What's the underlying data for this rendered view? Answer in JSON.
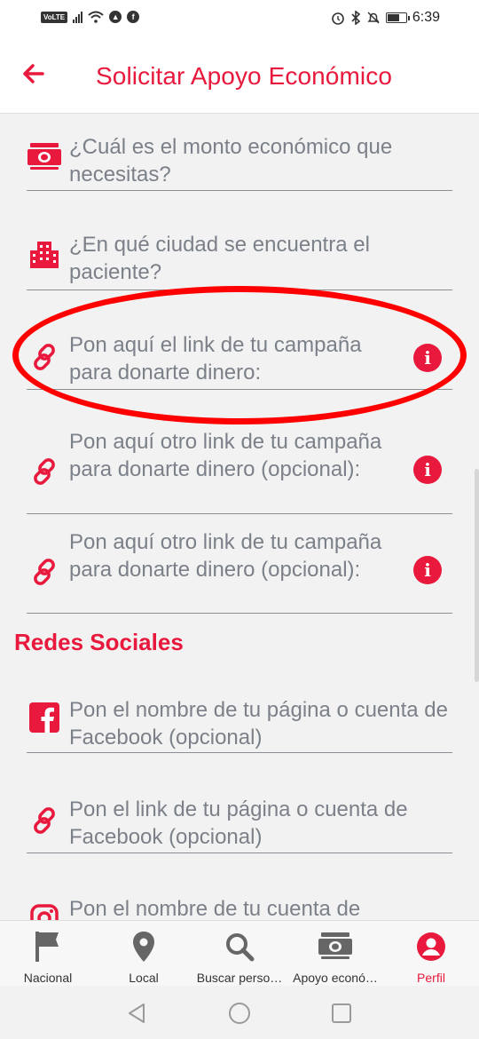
{
  "status_bar": {
    "time": "6:39",
    "volte": "VoLTE"
  },
  "app_bar": {
    "title": "Solicitar Apoyo Económico",
    "back_icon": "back-arrow-icon"
  },
  "fields": [
    {
      "icon": "money-icon",
      "text": "¿Cuál es el monto económico que necesitas?",
      "info": false
    },
    {
      "icon": "city-icon",
      "text": "¿En qué ciudad se encuentra el paciente?",
      "info": false
    },
    {
      "icon": "link-icon",
      "text": "Pon aquí el link de tu campaña para donarte dinero:",
      "info": true
    },
    {
      "icon": "link-icon",
      "text": "Pon aquí otro link de tu campaña para donarte dinero (opcional):",
      "info": true
    },
    {
      "icon": "link-icon",
      "text": "Pon aquí otro link de tu campaña para donarte dinero (opcional):",
      "info": true
    }
  ],
  "social_section": {
    "title": "Redes Sociales",
    "fields": [
      {
        "icon": "facebook-icon",
        "text": "Pon el nombre de tu página o cuenta de Facebook (opcional)"
      },
      {
        "icon": "link-icon",
        "text": "Pon el link de tu página o cuenta de Facebook (opcional)"
      },
      {
        "icon": "instagram-icon",
        "text": "Pon el nombre de tu cuenta de"
      }
    ]
  },
  "info_symbol": "i",
  "bottom_nav": [
    {
      "label": "Nacional",
      "icon": "flag-icon",
      "active": false
    },
    {
      "label": "Local",
      "icon": "map-pin-icon",
      "active": false
    },
    {
      "label": "Buscar perso…",
      "icon": "search-icon",
      "active": false
    },
    {
      "label": "Apoyo econó…",
      "icon": "money-icon",
      "active": false
    },
    {
      "label": "Perfil",
      "icon": "profile-icon",
      "active": true
    }
  ],
  "colors": {
    "accent": "#e8193c",
    "highlight": "#ff0000",
    "field_text": "#7b8089",
    "background": "#f2f2f2"
  }
}
